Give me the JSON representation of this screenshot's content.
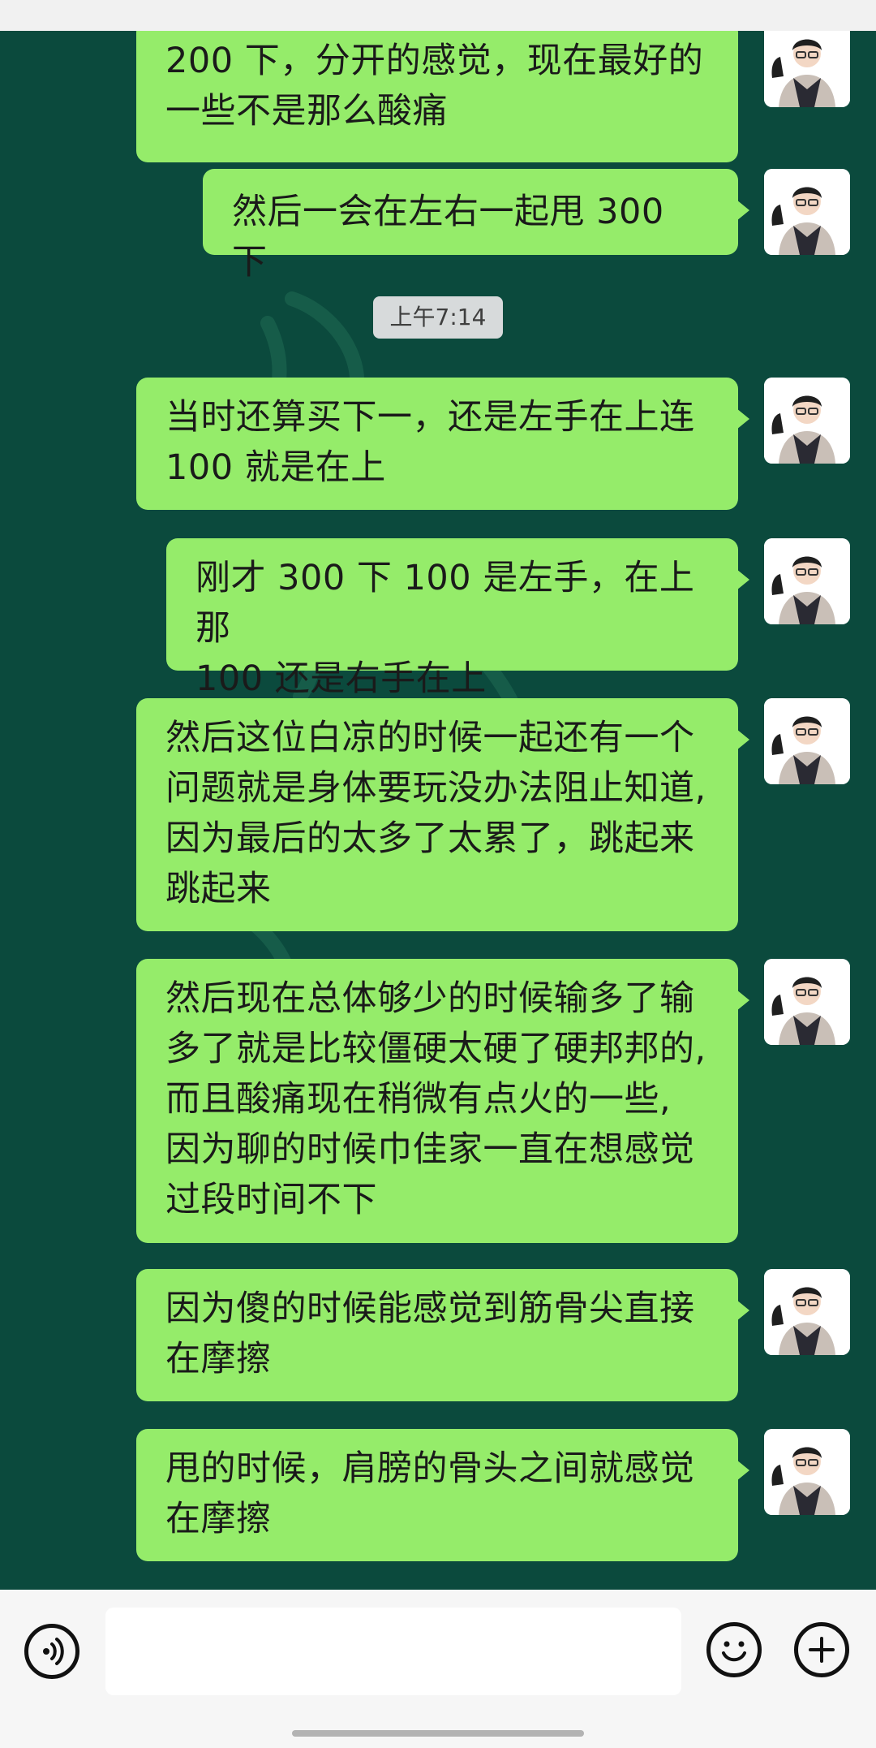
{
  "colors": {
    "chat_background": "#0b4a3d",
    "bubble": "#95ec6a",
    "timestamp_bg": "#d7dadb",
    "input_bar": "#f6f6f6"
  },
  "messages": [
    {
      "sender": "me",
      "text_lines": [
        "200 下，分开的感觉，现在最好的",
        "一些不是那么酸痛"
      ]
    },
    {
      "sender": "me",
      "text_lines": [
        "然后一会在左右一起甩 300 下"
      ]
    },
    {
      "sender": "me",
      "text_lines": [
        "当时还算买下一，还是左手在上连",
        "100 就是在上"
      ]
    },
    {
      "sender": "me",
      "text_lines": [
        "刚才 300 下 100 是左手，在上那",
        "100 还是右手在上"
      ]
    },
    {
      "sender": "me",
      "text_lines": [
        "然后这位白凉的时候一起还有一个",
        "问题就是身体要玩没办法阻止知道,",
        "因为最后的太多了太累了，跳起来",
        "跳起来"
      ]
    },
    {
      "sender": "me",
      "text_lines": [
        "然后现在总体够少的时候输多了输",
        "多了就是比较僵硬太硬了硬邦邦的,",
        "而且酸痛现在稍微有点火的一些,",
        "因为聊的时候巾佳家一直在想感觉",
        "过段时间不下"
      ]
    },
    {
      "sender": "me",
      "text_lines": [
        "因为傻的时候能感觉到筋骨尖直接",
        "在摩擦"
      ]
    },
    {
      "sender": "me",
      "text_lines": [
        "甩的时候，肩膀的骨头之间就感觉",
        "在摩擦"
      ]
    }
  ],
  "timestamp": "上午7:14",
  "input": {
    "value": "",
    "placeholder": ""
  },
  "icons": {
    "voice": "voice-wave-icon",
    "emoji": "smiley-face-icon",
    "more": "plus-circle-icon",
    "avatar": "person-avatar-icon"
  }
}
